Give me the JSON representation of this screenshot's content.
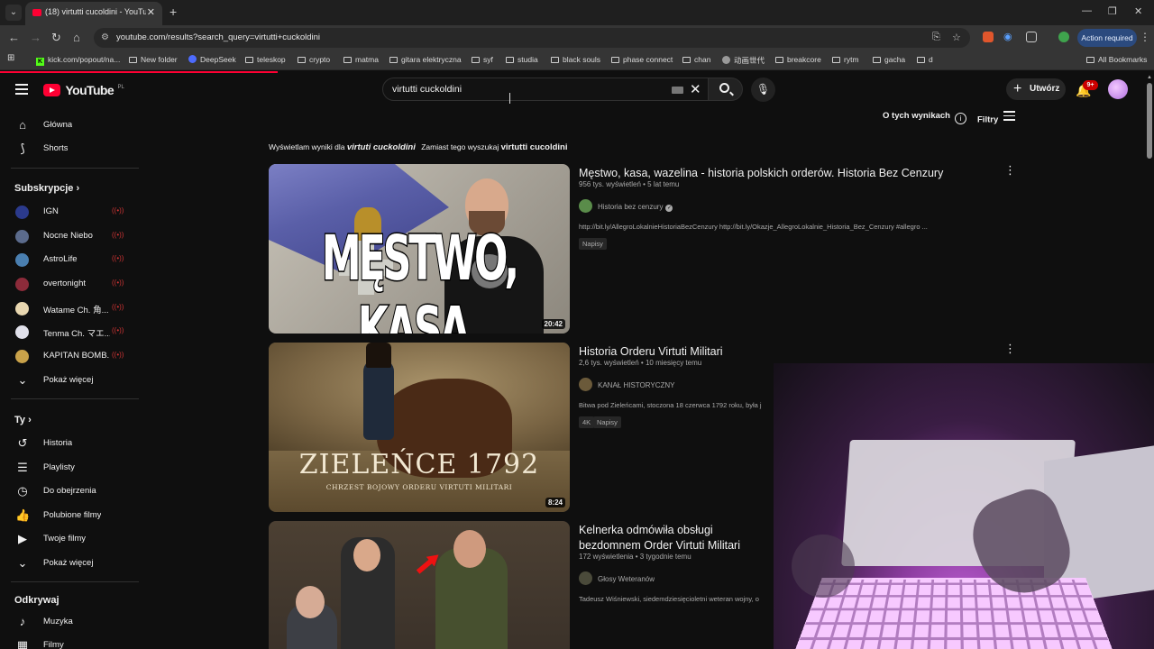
{
  "browser": {
    "tab_title": "(18) virtutti cucoldini - YouTube",
    "url": "youtube.com/results?search_query=virtutti+cuckoldini",
    "action_required": "Action required",
    "bookmarks": [
      {
        "label": "kick.com/popout/na...",
        "icon": "kick-icon"
      },
      {
        "label": "New folder",
        "icon": "folder-icon"
      },
      {
        "label": "DeepSeek",
        "icon": "deepseek-icon"
      },
      {
        "label": "teleskop",
        "icon": "folder-icon"
      },
      {
        "label": "crypto",
        "icon": "folder-icon"
      },
      {
        "label": "matma",
        "icon": "folder-icon"
      },
      {
        "label": "gitara elektryczna",
        "icon": "folder-icon"
      },
      {
        "label": "syf",
        "icon": "folder-icon"
      },
      {
        "label": "studia",
        "icon": "folder-icon"
      },
      {
        "label": "black souls",
        "icon": "folder-icon"
      },
      {
        "label": "phase connect",
        "icon": "folder-icon"
      },
      {
        "label": "chan",
        "icon": "folder-icon"
      },
      {
        "label": "动画世代",
        "icon": "globe-icon"
      },
      {
        "label": "breakcore",
        "icon": "folder-icon"
      },
      {
        "label": "rytm",
        "icon": "folder-icon"
      },
      {
        "label": "gacha",
        "icon": "folder-icon"
      },
      {
        "label": "d",
        "icon": "folder-icon"
      },
      {
        "label": "All Bookmarks",
        "icon": "folder-icon"
      }
    ]
  },
  "youtube": {
    "logo": "YouTube",
    "country": "PL",
    "search_query": "virtutti cuckoldini",
    "create_label": "Utwórz",
    "notifications": "9+",
    "about_results": "O tych wynikach",
    "filters": "Filtry",
    "spell": {
      "showing_prefix": "Wyświetlam wyniki dla",
      "showing_term": "virtuti cuckoldini",
      "instead_prefix": "Zamiast tego wyszukaj",
      "instead_term": "virtutti cucoldini"
    }
  },
  "sidebar": {
    "main": [
      {
        "label": "Główna",
        "icon": "home-icon"
      },
      {
        "label": "Shorts",
        "icon": "shorts-icon"
      }
    ],
    "subs_heading": "Subskrypcje",
    "subs": [
      {
        "label": "IGN",
        "color": "#2b3a8c"
      },
      {
        "label": "Nocne Niebo",
        "color": "#5b6b8c"
      },
      {
        "label": "AstroLife",
        "color": "#4a7fb0"
      },
      {
        "label": "overtonight",
        "color": "#8c2b3a"
      },
      {
        "label": "Watame Ch. 角...",
        "color": "#e8d7b0"
      },
      {
        "label": "Tenma Ch. マエ...",
        "color": "#e0e0ea"
      },
      {
        "label": "KAPITAN BOMB...",
        "color": "#c9a24a"
      }
    ],
    "show_more_1": "Pokaż więcej",
    "you_heading": "Ty",
    "you": [
      {
        "label": "Historia",
        "icon": "history-icon"
      },
      {
        "label": "Playlisty",
        "icon": "playlist-icon"
      },
      {
        "label": "Do obejrzenia",
        "icon": "clock-icon"
      },
      {
        "label": "Polubione filmy",
        "icon": "thumb-up-icon"
      },
      {
        "label": "Twoje filmy",
        "icon": "my-videos-icon"
      }
    ],
    "show_more_2": "Pokaż więcej",
    "explore_heading": "Odkrywaj",
    "explore": [
      {
        "label": "Muzyka",
        "icon": "music-icon"
      },
      {
        "label": "Filmy",
        "icon": "film-icon"
      }
    ]
  },
  "results": [
    {
      "title": "Męstwo, kasa, wazelina - historia polskich orderów. Historia Bez Cenzury",
      "views": "956 tys. wyświetleń",
      "age": "5 lat temu",
      "channel": "Historia bez cenzury",
      "verified": true,
      "description": "http://bit.ly/AllegroLokalnieHistoriaBezCenzury http://bit.ly/Okazje_AllegroLokalnie_Historia_Bez_Cenzury #allegro ...",
      "badges": [
        "Napisy"
      ],
      "duration": "20:42",
      "thumb_text": "MĘSTWO, KASA, WAZELINA"
    },
    {
      "title": "Historia Orderu Virtuti Militari",
      "views": "2,6 tys. wyświetleń",
      "age": "10 miesięcy temu",
      "channel": "KANAŁ HISTORYCZNY",
      "verified": false,
      "description": "Bitwa pod Zieleńcami, stoczona 18 czerwca 1792 roku, była j",
      "badges": [
        "4K",
        "Napisy"
      ],
      "duration": "8:24",
      "thumb_text": "ZIELEŃCE 1792",
      "thumb_sub": "CHRZEST BOJOWY ORDERU VIRTUTI MILITARI"
    },
    {
      "title": "Kelnerka odmówiła obsługi bezdomnem Order Virtuti Militari",
      "views": "172 wyświetlenia",
      "age": "3 tygodnie temu",
      "channel": "Głosy Weteranów",
      "verified": false,
      "description": "Tadeusz Wiśniewski, siedemdziesięcioletni weteran wojny, o"
    }
  ]
}
